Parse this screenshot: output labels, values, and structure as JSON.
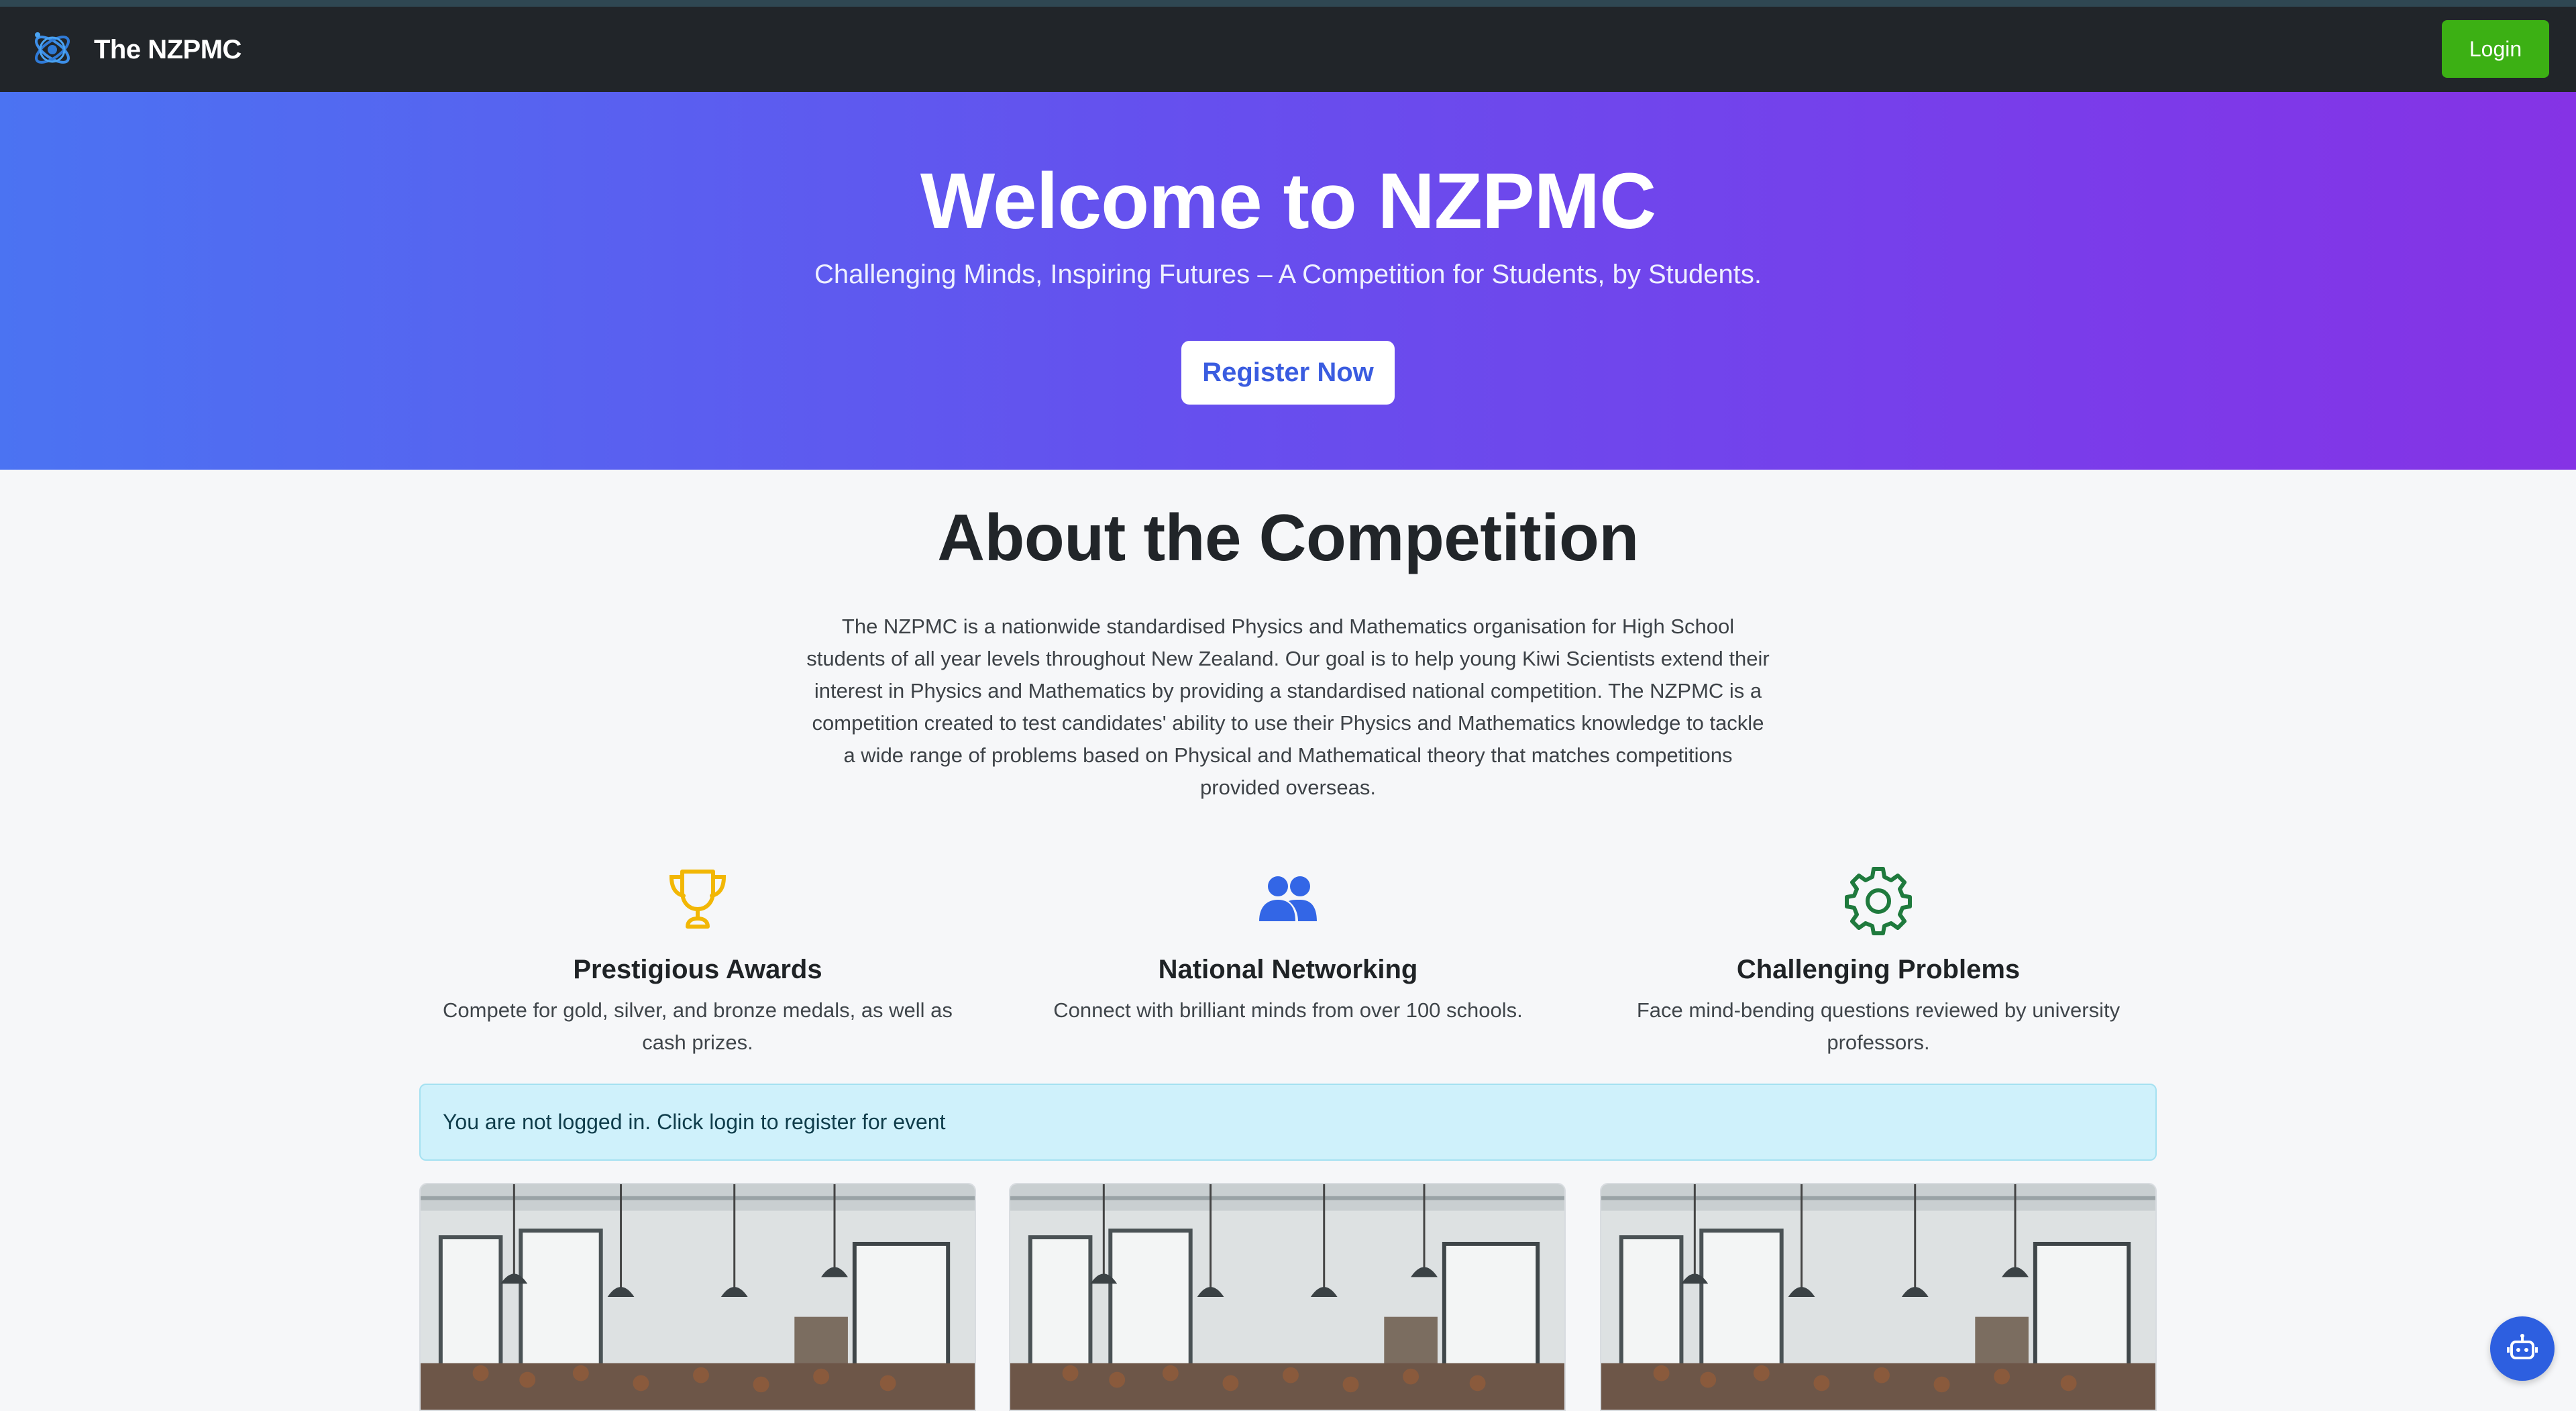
{
  "navbar": {
    "brand_text": "The NZPMC",
    "login_label": "Login"
  },
  "hero": {
    "title": "Welcome to NZPMC",
    "subtitle": "Challenging Minds, Inspiring Futures – A Competition for Students, by Students.",
    "register_label": "Register Now"
  },
  "about": {
    "title": "About the Competition",
    "text": "The NZPMC is a nationwide standardised Physics and Mathematics organisation for High School students of all year levels throughout New Zealand. Our goal is to help young Kiwi Scientists extend their interest in Physics and Mathematics by providing a standardised national competition. The NZPMC is a competition created to test candidates' ability to use their Physics and Mathematics knowledge to tackle a wide range of problems based on Physical and Mathematical theory that matches competitions provided overseas."
  },
  "features": [
    {
      "icon": "trophy-icon",
      "title": "Prestigious Awards",
      "desc": "Compete for gold, silver, and bronze medals, as well as cash prizes."
    },
    {
      "icon": "users-icon",
      "title": "National Networking",
      "desc": "Connect with brilliant minds from over 100 schools."
    },
    {
      "icon": "gear-icon",
      "title": "Challenging Problems",
      "desc": "Face mind-bending questions reviewed by university professors."
    }
  ],
  "alert": {
    "text": "You are not logged in. Click login to register for event"
  },
  "event_cards": [
    {
      "image": "exam-hall-image"
    },
    {
      "image": "exam-hall-image"
    },
    {
      "image": "exam-hall-image"
    }
  ],
  "colors": {
    "navbar_bg": "#212529",
    "login_green": "#3cb014",
    "hero_gradient_start": "#4b73f2",
    "hero_gradient_end": "#8533e5",
    "alert_bg": "#cff1fb",
    "trophy_gold": "#f2b705",
    "users_blue": "#3366e6",
    "gear_green": "#1f7a3d",
    "chat_blue": "#2d5fe0"
  },
  "chat": {
    "icon": "chatbot-icon"
  }
}
